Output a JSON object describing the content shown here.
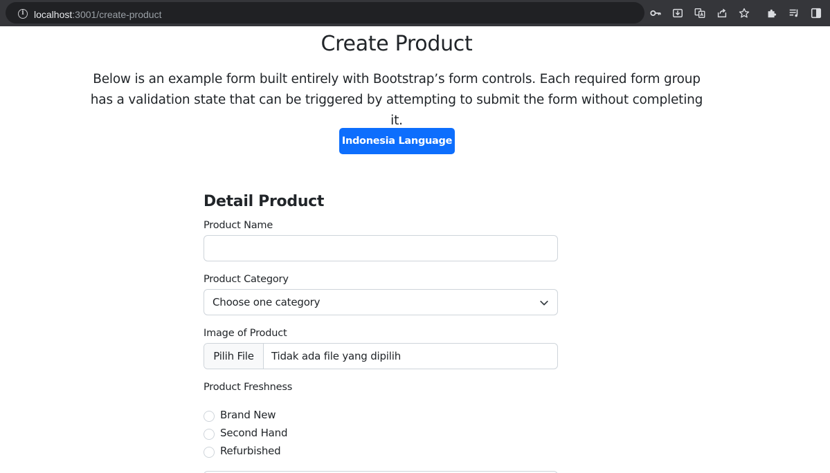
{
  "browser": {
    "url_host": "localhost",
    "url_path": ":3001/create-product",
    "icons": [
      "info-icon",
      "key-icon",
      "install-icon",
      "translate-icon",
      "share-icon",
      "star-icon",
      "extensions-icon",
      "media-icon",
      "side-panel-icon"
    ]
  },
  "page": {
    "title": "Create Product",
    "lead": "Below is an example form built entirely with Bootstrap’s form controls. Each required form group has a validation state that can be triggered by attempting to submit the form without completing it.",
    "language_button": "Indonesia Language"
  },
  "form": {
    "section_title": "Detail Product",
    "product_name": {
      "label": "Product Name",
      "value": ""
    },
    "product_category": {
      "label": "Product Category",
      "selected": "Choose one category"
    },
    "image": {
      "label": "Image of Product",
      "button": "Pilih File",
      "status": "Tidak ada file yang dipilih"
    },
    "freshness": {
      "label": "Product Freshness",
      "options": [
        "Brand New",
        "Second Hand",
        "Refurbished"
      ]
    }
  },
  "colors": {
    "primary": "#0d6efd",
    "browser_bar": "#35363a",
    "url_pill": "#202124",
    "border": "#ced4da"
  }
}
